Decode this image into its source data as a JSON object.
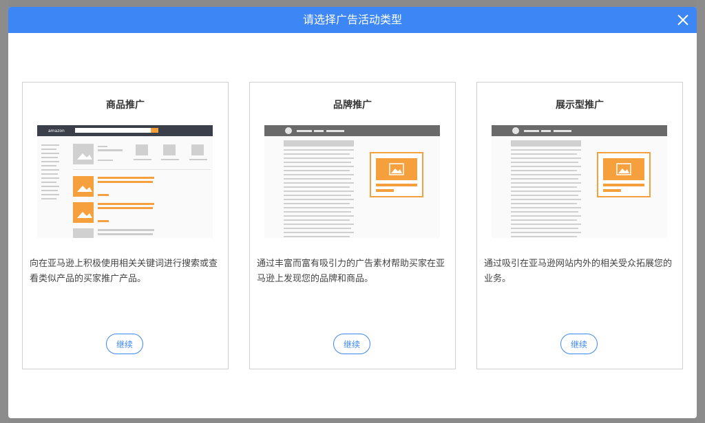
{
  "modal": {
    "title": "请选择广告活动类型",
    "close_icon": "close-icon"
  },
  "cards": [
    {
      "title": "商品推广",
      "description": "向在亚马逊上积极使用相关关键词进行搜索或查看类似产品的买家推广产品。",
      "button": "继续",
      "illustration_logo": "amazon"
    },
    {
      "title": "品牌推广",
      "description": "通过丰富而富有吸引力的广告素材帮助买家在亚马逊上发现您的品牌和商品。",
      "button": "继续"
    },
    {
      "title": "展示型推广",
      "description": "通过吸引在亚马逊网站内外的相关受众拓展您的业务。",
      "button": "继续"
    }
  ],
  "colors": {
    "header": "#3d86f5",
    "accent_orange": "#f5a03c",
    "border": "#cfcfcf"
  }
}
